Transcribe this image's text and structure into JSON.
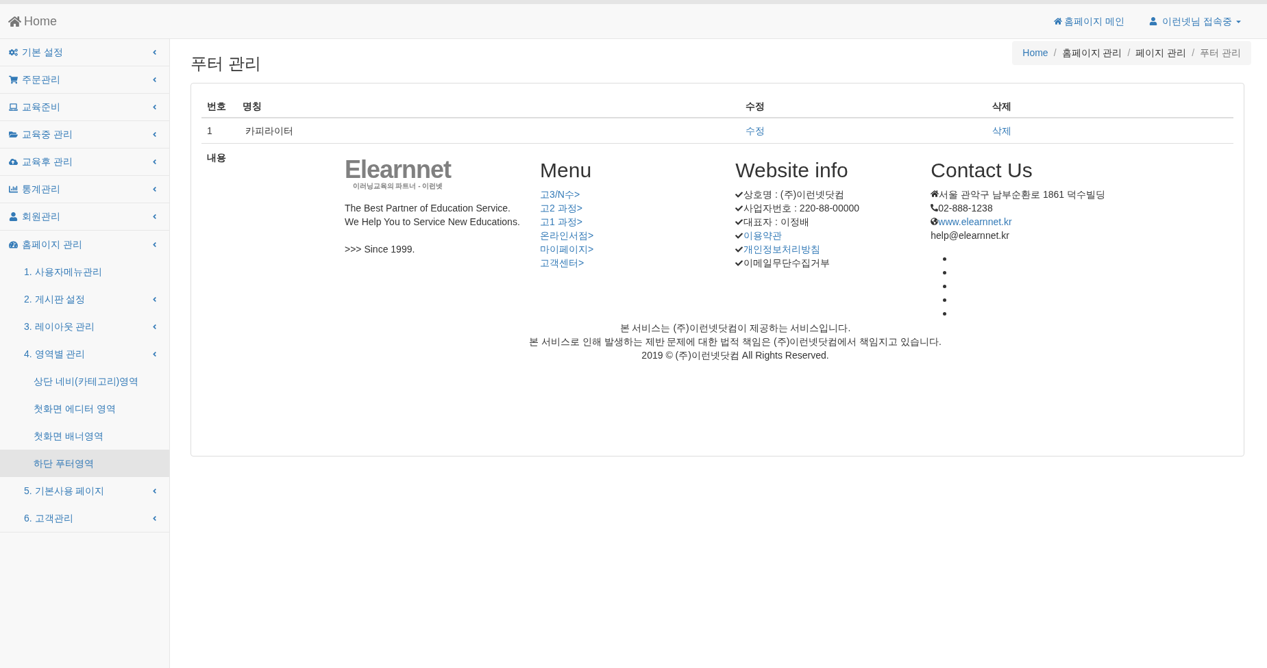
{
  "navbar": {
    "brand": "Home",
    "links": [
      {
        "label": "홈페이지 메인",
        "kind": "home"
      },
      {
        "label": "이런넷님 접속중",
        "kind": "user"
      }
    ]
  },
  "sidebar": {
    "items": [
      {
        "label": "기본 설정",
        "submenu": true,
        "selected": false
      },
      {
        "label": "주문관리",
        "submenu": true,
        "selected": false
      },
      {
        "label": "교육준비",
        "submenu": true,
        "selected": false
      },
      {
        "label": "교육중 관리",
        "submenu": true,
        "selected": false
      },
      {
        "label": "교육후 관리",
        "submenu": true,
        "selected": false
      },
      {
        "label": "통계관리",
        "submenu": true,
        "selected": false
      },
      {
        "label": "회원관리",
        "submenu": true,
        "selected": false
      },
      {
        "label": "홈페이지 관리",
        "submenu": true,
        "selected": false,
        "children": [
          {
            "label": "1. 사용자메뉴관리",
            "submenu": false,
            "selected": false
          },
          {
            "label": "2. 게시판 설정",
            "submenu": true,
            "selected": false
          },
          {
            "label": "3. 레이아웃 관리",
            "submenu": true,
            "selected": false
          },
          {
            "label": "4. 영역별 관리",
            "submenu": true,
            "selected": false,
            "children": [
              {
                "label": "상단 네비(카테고리)영역",
                "submenu": false,
                "selected": false
              },
              {
                "label": "첫화면 에디터 영역",
                "submenu": false,
                "selected": false
              },
              {
                "label": "첫화면 배너영역",
                "submenu": false,
                "selected": false
              },
              {
                "label": "하단 푸터영역",
                "submenu": false,
                "selected": true
              }
            ]
          },
          {
            "label": "5. 기본사용 페이지",
            "submenu": true,
            "selected": false
          },
          {
            "label": "6. 고객관리",
            "submenu": true,
            "selected": false
          }
        ]
      }
    ]
  },
  "page_title": "푸터 관리",
  "breadcrumb": {
    "items": [
      "Home",
      "홈페이지 관리",
      "페이지 관리",
      "푸터 관리"
    ],
    "separators": [
      "/",
      "/",
      "/"
    ]
  },
  "table": {
    "columns": [
      "번호",
      "명칭",
      "수정",
      "삭제"
    ],
    "rows": [
      {
        "cells": [
          "1",
          "카피라이터",
          "수정",
          "삭제"
        ]
      }
    ],
    "content_label": "내용"
  },
  "footer_preview": {
    "logo": {
      "name": "Elearnnet",
      "tagline": "이러닝교육의 파트너 - 이런넷"
    },
    "about": [
      "The Best Partner of Education Service.",
      "We Help You to Service New Educations."
    ],
    "since": ">>> Since 1999.",
    "menu": {
      "title": "Menu",
      "links": [
        "고3/N수>",
        "고2 과정>",
        "고1 과정>",
        "온라인서점>",
        "마이페이지>",
        "고객센터>"
      ]
    },
    "website_info": {
      "title": "Website info",
      "items": [
        {
          "text": "상호명 : (주)이런넷닷컴",
          "kind": "text"
        },
        {
          "text": "사업자번호 : 220-88-00000",
          "kind": "text"
        },
        {
          "text": "대표자 : 이정배",
          "kind": "text"
        },
        {
          "text": "이용약관",
          "kind": "link"
        },
        {
          "text": "개인정보처리방침",
          "kind": "link"
        },
        {
          "text": "이메일무단수집거부",
          "kind": "text"
        }
      ]
    },
    "contact": {
      "title": "Contact Us",
      "items": [
        {
          "text": "서울 관악구 남부순환로 1861 덕수빌딩",
          "kind": "address"
        },
        {
          "text": "02-888-1238",
          "kind": "phone"
        },
        {
          "text": "www.elearnnet.kr",
          "kind": "web"
        },
        {
          "text": "help@elearnnet.kr",
          "kind": "plain"
        }
      ],
      "empty_list": [
        {
          "kind": "bullet"
        },
        {
          "kind": "bullet"
        },
        {
          "kind": "bullet"
        },
        {
          "kind": "bullet"
        },
        {
          "kind": "bullet"
        }
      ]
    },
    "copyright": [
      "본 서비스는 (주)이런넷닷컴이 제공하는 서비스입니다.",
      "본 서비스로 인해 발생하는 제반 문제에 대한 법적 책임은 (주)이런넷닷컴에서 책임지고 있습니다.",
      "2019 © (주)이런넷닷컴 All Rights Reserved."
    ]
  }
}
